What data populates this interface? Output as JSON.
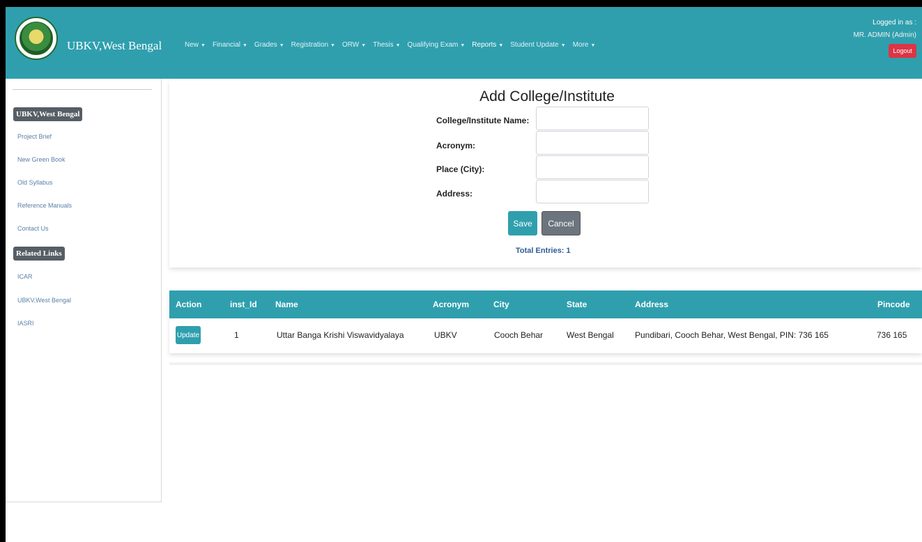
{
  "header": {
    "brand": "UBKV,West Bengal",
    "menu": [
      {
        "label": "New",
        "bold": false
      },
      {
        "label": "Financial",
        "bold": false
      },
      {
        "label": "Grades",
        "bold": false
      },
      {
        "label": "Registration",
        "bold": false
      },
      {
        "label": "ORW",
        "bold": false
      },
      {
        "label": "Thesis",
        "bold": false
      },
      {
        "label": "Qualifying Exam",
        "bold": false
      },
      {
        "label": "Reports",
        "bold": true
      },
      {
        "label": "Student Update",
        "bold": false
      },
      {
        "label": "More",
        "bold": false
      }
    ],
    "logged_in_label": "Logged in as :",
    "user": "MR. ADMIN (Admin)",
    "logout": "Logout"
  },
  "sidebar": {
    "section1": "UBKV,West Bengal",
    "links1": [
      "Project Brief",
      "New Green Book",
      "Old Syllabus",
      "Reference Manuals",
      "Contact Us"
    ],
    "section2": "Related Links",
    "links2": [
      "ICAR",
      "UBKV,West Bengal",
      "IASRI"
    ]
  },
  "form": {
    "title": "Add College/Institute",
    "fields": [
      {
        "label": "College/Institute Name:",
        "value": ""
      },
      {
        "label": "Acronym:",
        "value": ""
      },
      {
        "label": "Place (City):",
        "value": ""
      },
      {
        "label": "Address:",
        "value": ""
      }
    ],
    "save": "Save",
    "cancel": "Cancel",
    "total": "Total Entries: 1"
  },
  "table": {
    "headers": [
      "Action",
      "inst_Id",
      "Name",
      "Acronym",
      "City",
      "State",
      "Address",
      "Pincode"
    ],
    "rows": [
      {
        "action": "Update",
        "inst_id": "1",
        "name": "Uttar Banga Krishi Viswavidyalaya",
        "acronym": "UBKV",
        "city": "Cooch Behar",
        "state": "West Bengal",
        "address": "Pundibari, Cooch Behar, West Bengal, PIN: 736 165",
        "pincode": "736 165"
      }
    ]
  },
  "colors": {
    "primary": "#2f9fae",
    "danger": "#dc3545",
    "secondary": "#6c757d",
    "sidebar_link": "#5a7fa8"
  }
}
